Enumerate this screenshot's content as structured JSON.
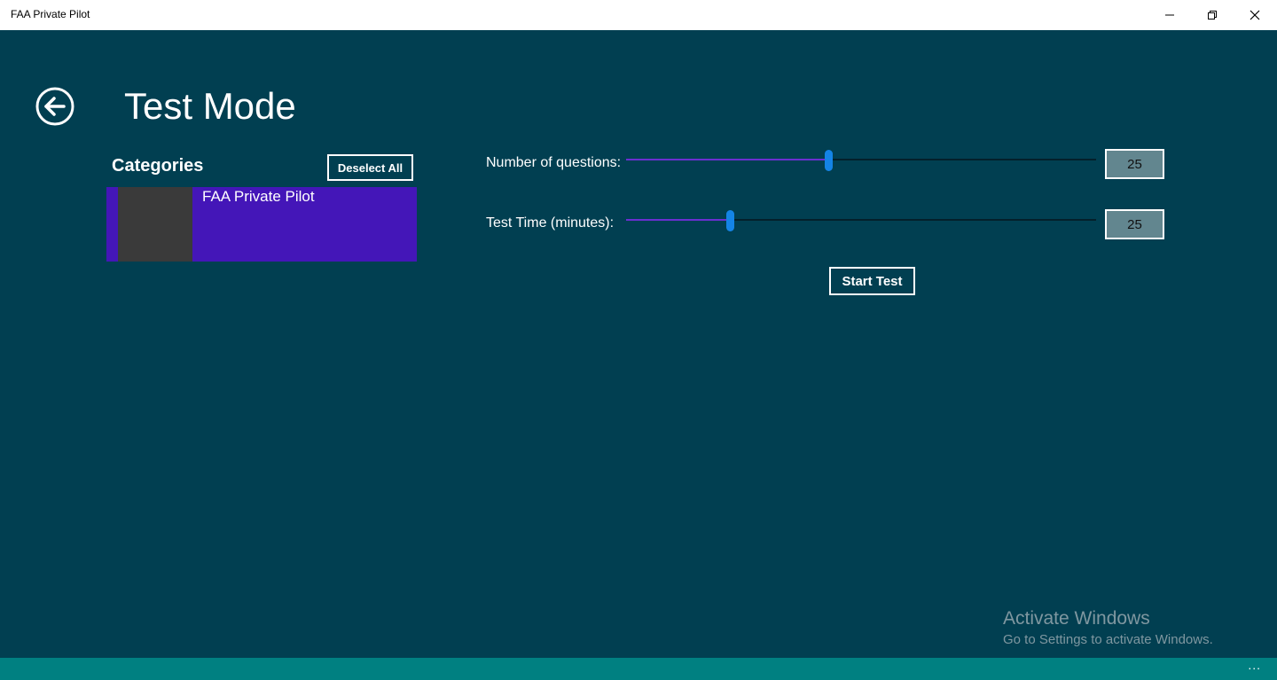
{
  "window": {
    "title": "FAA Private Pilot",
    "minimize_icon": "minimize-icon",
    "maximize_icon": "restore-icon",
    "close_icon": "close-icon"
  },
  "header": {
    "back_icon": "back-arrow-circle-icon",
    "title": "Test Mode"
  },
  "categories": {
    "header": "Categories",
    "deselect_label": "Deselect All",
    "items": [
      {
        "label": "FAA Private Pilot",
        "selected": true
      }
    ]
  },
  "settings": {
    "questions": {
      "label": "Number of questions:",
      "value": "25",
      "level_fraction": 0.43
    },
    "time": {
      "label": "Test Time (minutes):",
      "value": "25",
      "level_fraction": 0.22
    },
    "start_label": "Start Test"
  },
  "watermark": {
    "title": "Activate Windows",
    "subtitle": "Go to Settings to activate Windows."
  },
  "appbar": {
    "more_label": "..."
  },
  "colors": {
    "background": "#013f51",
    "selected_item": "#4416b8",
    "slider_fill": "#6a2fd0",
    "slider_thumb": "#1484e6",
    "appbar": "#008081"
  }
}
